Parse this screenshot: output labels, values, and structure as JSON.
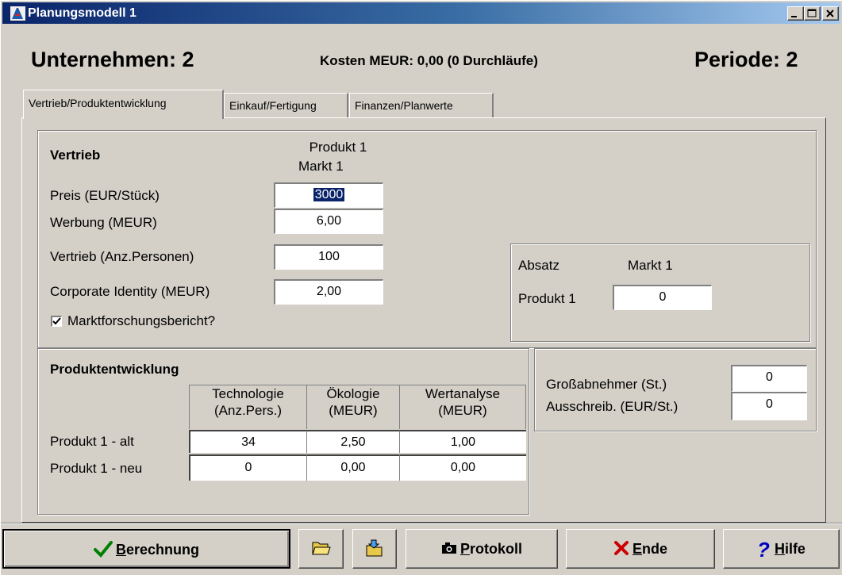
{
  "window": {
    "title": "Planungsmodell 1"
  },
  "header": {
    "company": "Unternehmen: 2",
    "costs": "Kosten MEUR: 0,00 (0 Durchläufe)",
    "period": "Periode: 2"
  },
  "tabs": [
    {
      "label": "Vertrieb/Produktentwicklung",
      "active": true
    },
    {
      "label": "Einkauf/Fertigung",
      "active": false
    },
    {
      "label": "Finanzen/Planwerte",
      "active": false
    }
  ],
  "vertrieb": {
    "title": "Vertrieb",
    "col_product": "Produkt 1",
    "col_market": "Markt 1",
    "rows": [
      {
        "label": "Preis (EUR/Stück)",
        "value": "3000"
      },
      {
        "label": "Werbung (MEUR)",
        "value": "6,00"
      },
      {
        "label": "Vertrieb (Anz.Personen)",
        "value": "100"
      },
      {
        "label": "Corporate Identity (MEUR)",
        "value": "2,00"
      }
    ],
    "checkbox_label": "Marktforschungsbericht?",
    "checkbox_checked": true
  },
  "absatz": {
    "title": "Absatz",
    "market": "Markt 1",
    "product": "Produkt 1",
    "value": "0"
  },
  "grossabnehmer": {
    "rows": [
      {
        "label": "Großabnehmer (St.)",
        "value": "0"
      },
      {
        "label": "Ausschreib. (EUR/St.)",
        "value": "0"
      }
    ]
  },
  "produktentwicklung": {
    "title": "Produktentwicklung",
    "headers": [
      {
        "line1": "Technologie",
        "line2": "(Anz.Pers.)"
      },
      {
        "line1": "Ökologie",
        "line2": "(MEUR)"
      },
      {
        "line1": "Wertanalyse",
        "line2": "(MEUR)"
      }
    ],
    "rows": [
      {
        "label": "Produkt 1 - alt",
        "values": [
          "34",
          "2,50",
          "1,00"
        ]
      },
      {
        "label": "Produkt 1 - neu",
        "values": [
          "0",
          "0,00",
          "0,00"
        ]
      }
    ]
  },
  "buttons": {
    "berechnung": {
      "label_u": "B",
      "label_rest": "erechnung"
    },
    "protokoll": {
      "label_u": "P",
      "label_rest": "rotokoll"
    },
    "ende": {
      "label_u": "E",
      "label_rest": "nde"
    },
    "hilfe": {
      "label_u": "H",
      "label_rest": "ilfe"
    }
  },
  "icons": {
    "app": "app-icon",
    "minimize": "minimize-icon",
    "maximize": "maximize-icon",
    "close": "close-icon",
    "open": "open-folder-icon",
    "save": "save-folder-icon",
    "camera": "camera-icon",
    "check": "checkmark-icon",
    "cross": "cross-icon",
    "help": "question-mark-icon"
  },
  "colors": {
    "titlebar": "#0a246a",
    "check": "#008000",
    "cross": "#cc0000",
    "help": "#0000c0",
    "face": "#d4d0c8"
  }
}
